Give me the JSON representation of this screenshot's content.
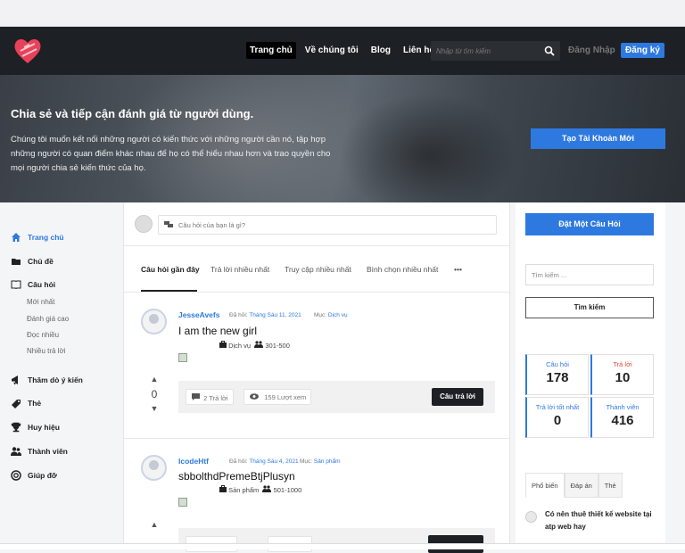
{
  "nav": {
    "links": [
      "Trang chủ",
      "Về chúng tôi",
      "Blog",
      "Liên hệ"
    ],
    "search_placeholder": "Nhập từ tìm kiếm",
    "login": "Đăng Nhập",
    "signup": "Đăng ký"
  },
  "hero": {
    "title": "Chia sẻ và tiếp cận đánh giá từ người dùng.",
    "description": "Chúng tôi muốn kết nối những người có kiến thức với những người cần nó, tập hợp những người có quan điểm khác nhau để họ có thể hiểu nhau hơn và trao quyền cho mọi người chia sẻ kiến thức của họ.",
    "cta": "Tạo Tài Khoản Mới"
  },
  "sidebar": {
    "items": [
      "Trang chủ",
      "Chủ đề",
      "Câu hỏi",
      "Thăm dò ý kiến",
      "Thẻ",
      "Huy hiệu",
      "Thành viên",
      "Giúp đỡ"
    ],
    "sub_items": [
      "Mới nhất",
      "Đánh giá cao",
      "Đọc nhiều",
      "Nhiều trả lời"
    ]
  },
  "main": {
    "ask_placeholder": "Câu hỏi của bạn là gì?",
    "tabs": [
      "Câu hỏi gần đây",
      "Trả lời nhiều nhất",
      "Truy cập nhiều nhất",
      "Bình chọn nhiều nhất",
      "•••"
    ],
    "questions": [
      {
        "user": "JesseAvefs",
        "asked_label": "Đã hỏi:",
        "date": "Tháng Sáu 11, 2021",
        "category_label": "Mục:",
        "category": "Dịch vụ",
        "title": "I am the new girl",
        "tag1": "Dịch vụ",
        "tag2": "301-500",
        "vote_up": "▲",
        "votes": "0",
        "vote_down": "▼",
        "answers": "2 Trả lời",
        "views": "159 Lượt xem",
        "answer_btn": "Câu trả lời"
      },
      {
        "user": "IcodeHtf",
        "asked_label": "Đã hỏi:",
        "date": "Tháng Sáu 4, 2021",
        "category_label": "Mục:",
        "category": "Sản phẩm",
        "title": "sbbolthdPremeBtjPlusyn",
        "tag1": "Sản phẩm",
        "tag2": "501-1000",
        "vote_up": "▲"
      }
    ]
  },
  "right": {
    "ask_btn": "Đặt Một Câu Hỏi",
    "search_placeholder": "Tìm kiếm ...",
    "search_btn": "Tìm kiếm",
    "stats": [
      {
        "label": "Câu hỏi",
        "value": "178",
        "color": "#2e79e0"
      },
      {
        "label": "Trả lời",
        "value": "10",
        "color": "#e0453a"
      },
      {
        "label": "Trả lời tốt nhất",
        "value": "0",
        "color": "#2e79e0"
      },
      {
        "label": "Thành viên",
        "value": "416",
        "color": "#2e79e0"
      }
    ],
    "tabs": [
      "Phổ biến",
      "Đáp án",
      "Thẻ"
    ],
    "popular_title": "Có nên thuê thiết kế website tại atp web hay"
  }
}
